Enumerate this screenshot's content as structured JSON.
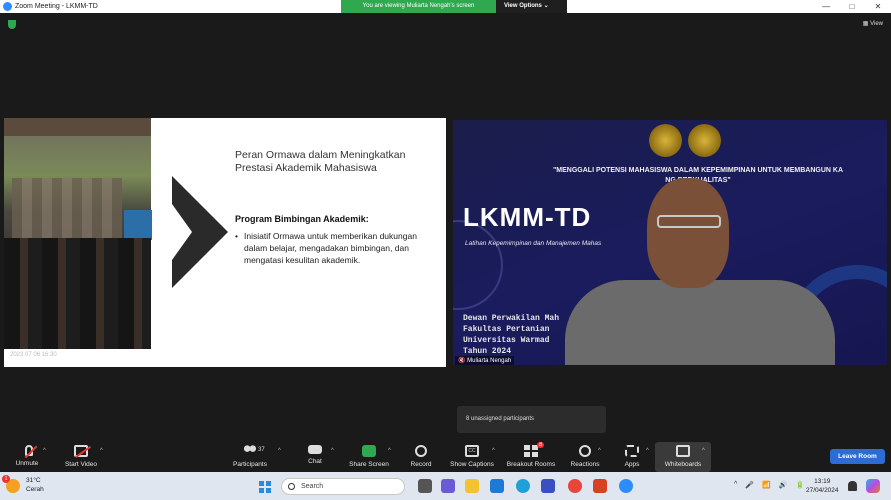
{
  "window": {
    "title": "Zoom Meeting - LKMM-TD",
    "banner_text": "You are viewing Muliarta Nengah's screen",
    "view_options": "View Options ⌄",
    "controls": [
      "—",
      "□",
      "✕"
    ]
  },
  "view_button": "View",
  "shared_slide": {
    "photo_timestamp": "2023 07 06 16:30",
    "title": "Peran Ormawa dalam Meningkatkan Prestasi Akademik Mahasiswa",
    "subtitle": "Program Bimbingan Akademik:",
    "bullet": "Inisiatif Ormawa untuk memberikan dukungan dalam belajar, mengadakan bimbingan, dan mengatasi kesulitan akademik."
  },
  "video_tile": {
    "quote": "\"MENGGALI POTENSI MAHASISWA DALAM KEPEMIMPINAN UNTUK MEMBANGUN KA          NG BERKUALITAS\"",
    "big_title": "LKMM-TD",
    "subtitle": "Latihan Kepemimpinan dan Manajemen Mahas",
    "org_lines": [
      "Dewan Perwakilan Mah",
      "Fakultas Pertanian",
      "Universitas Warmad",
      "Tahun 2024"
    ],
    "participant_name": "Muliarta Nengah"
  },
  "popup": {
    "unassigned": "8 unassigned participants"
  },
  "toolbar": {
    "unmute": "Unmute",
    "start_video": "Start Video",
    "participants": "Participants",
    "participant_count": "37",
    "chat": "Chat",
    "share_screen": "Share Screen",
    "record": "Record",
    "show_captions": "Show Captions",
    "breakout_rooms": "Breakout Rooms",
    "breakout_badge": "8",
    "reactions": "Reactions",
    "apps": "Apps",
    "whiteboards": "Whiteboards",
    "leave": "Leave Room",
    "caret": "^"
  },
  "taskbar": {
    "weather_badge": "1",
    "temperature": "31°C",
    "condition": "Cerah",
    "search_placeholder": "Search",
    "time": "13:19",
    "date": "27/04/2024",
    "tray_icons": [
      "^",
      "🎤",
      "📶",
      "🔊",
      "🔋"
    ]
  },
  "colors": {
    "banner_green": "#2fa84f",
    "leave_blue": "#2d6cd4",
    "video_bg": "#1a1c5e",
    "toolbar_bg": "#1a1a1a",
    "taskbar_bg": "#dfe6ef"
  }
}
